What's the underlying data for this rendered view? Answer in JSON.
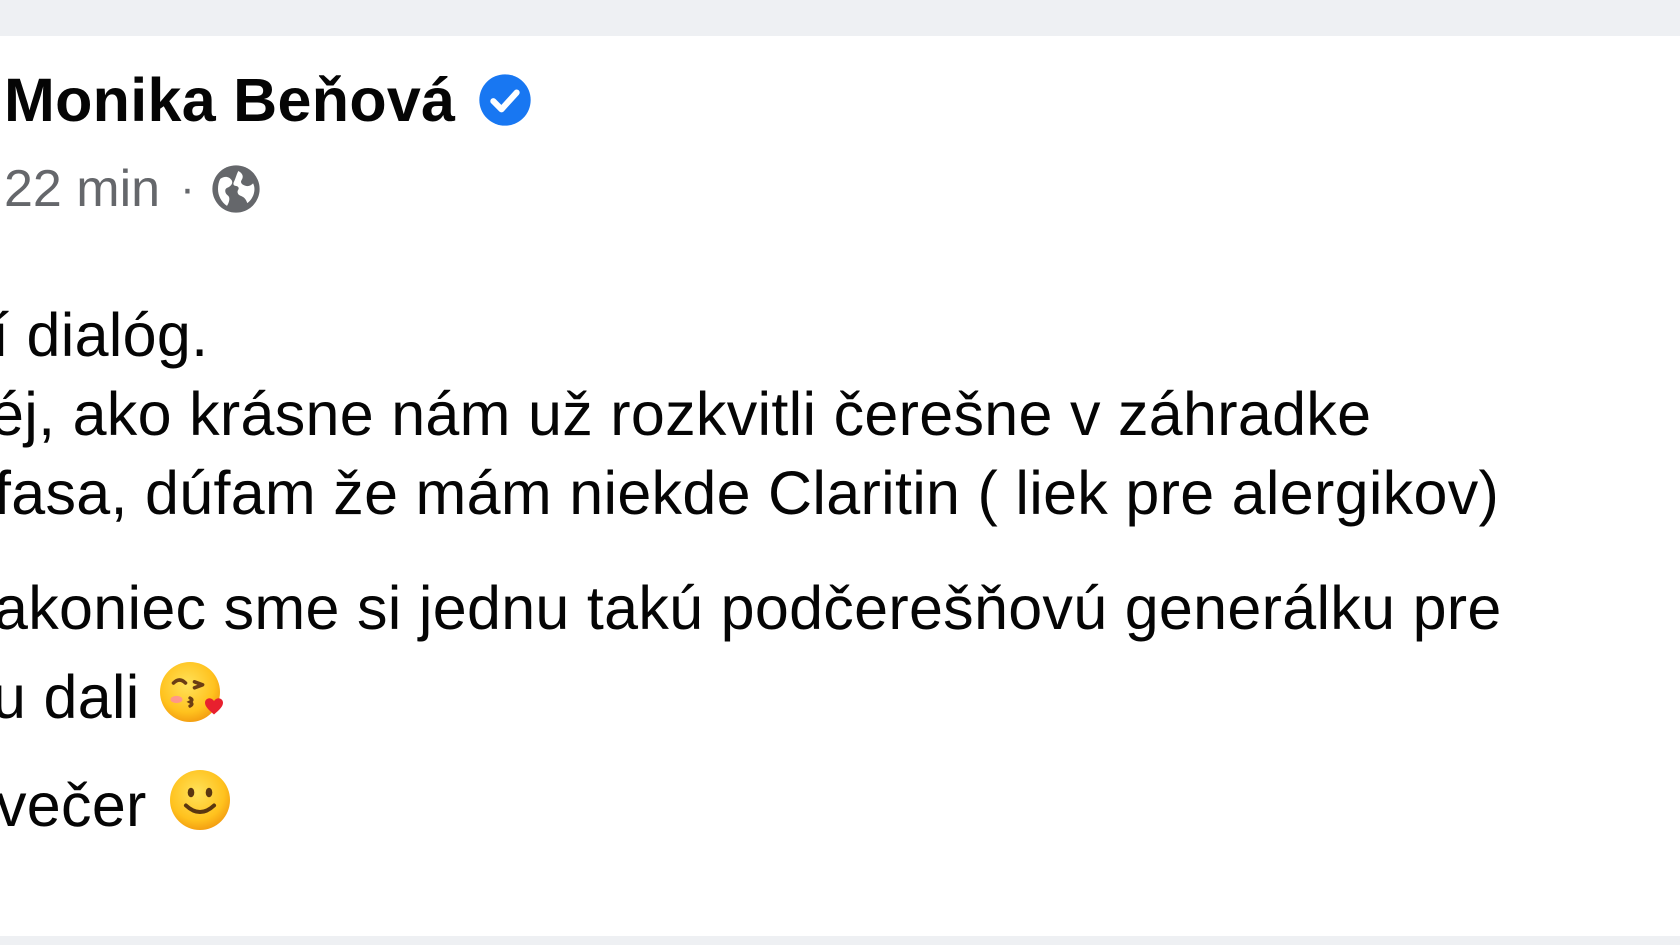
{
  "post": {
    "author": "Monika Beňová",
    "time": "22 min",
    "separator": "·",
    "lines": [
      "í dialóg.",
      "éj, ako krásne nám už rozkvitli čerešne v záhradke",
      " fasa, dúfam že mám niekde Claritin ( liek pre alergikov)",
      "akoniec sme si jednu takú podčerešňovú generálku pre",
      "u dali",
      "večer "
    ]
  },
  "icons": {
    "verified": "verified-badge-icon",
    "audience": "globe-icon",
    "kiss_emoji": "face-blowing-a-kiss-emoji",
    "smile_emoji": "slightly-smiling-face-emoji"
  },
  "colors": {
    "verified_blue": "#1877f2",
    "meta_gray": "#65676b",
    "text": "#050505",
    "background_band": "#eef0f3"
  }
}
